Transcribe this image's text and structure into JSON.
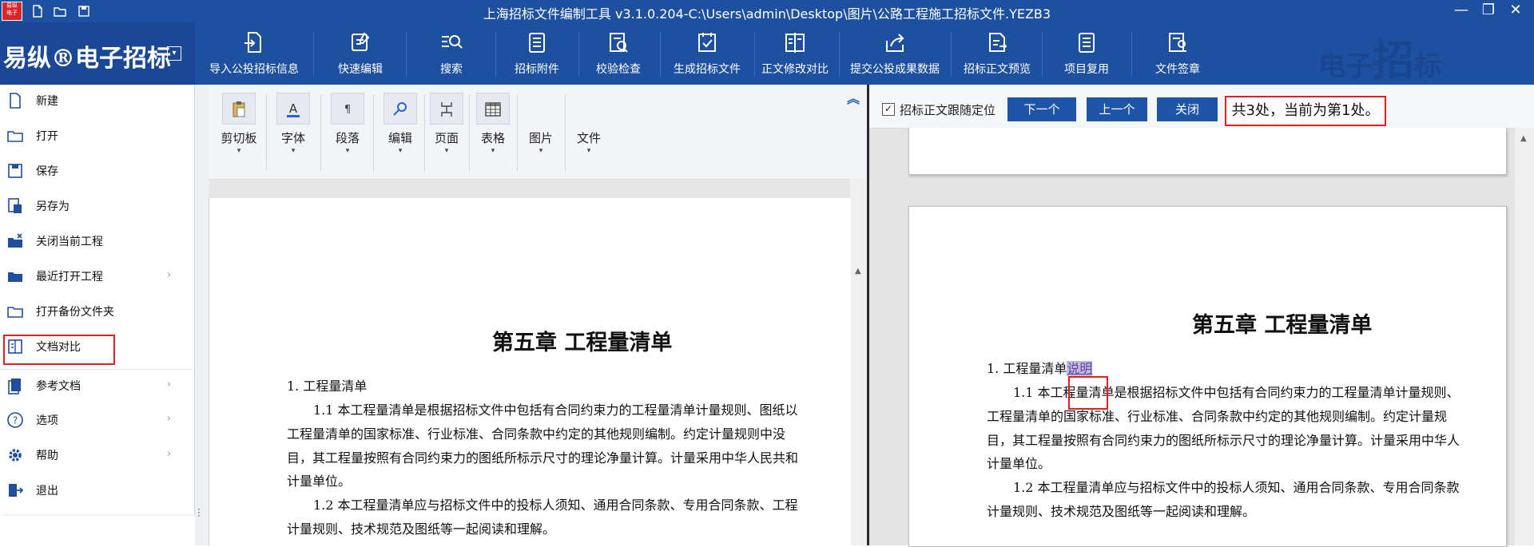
{
  "titlebar": {
    "logo_text": "易纵电子招标",
    "title": "上海招标文件编制工具 v3.1.0.204-C:\\Users\\admin\\Desktop\\图片\\公路工程施工招标文件.YEZB3",
    "quick_icons": [
      "new-file-icon",
      "open-folder-icon",
      "save-icon"
    ],
    "window_buttons": [
      "minimize-icon",
      "restore-icon",
      "close-icon"
    ]
  },
  "brand": {
    "name": "易纵®电子招标",
    "dropdown_icon": "chevron-down-icon"
  },
  "ribbon": {
    "buttons": [
      {
        "label": "导入公投招标信息",
        "icon": "import-icon"
      },
      {
        "label": "快速编辑",
        "icon": "edit-icon"
      },
      {
        "label": "搜索",
        "icon": "search-list-icon"
      },
      {
        "label": "招标附件",
        "icon": "attachment-icon"
      },
      {
        "label": "校验检查",
        "icon": "check-doc-icon"
      },
      {
        "label": "生成招标文件",
        "icon": "generate-icon"
      },
      {
        "label": "正文修改对比",
        "icon": "compare-icon"
      },
      {
        "label": "提交公投成果数据",
        "icon": "share-icon"
      },
      {
        "label": "招标正文预览",
        "icon": "preview-icon"
      },
      {
        "label": "项目复用",
        "icon": "reuse-icon"
      },
      {
        "label": "文件签章",
        "icon": "seal-icon"
      }
    ],
    "watermark": {
      "left": "电子",
      "big": "招",
      "right": "标"
    }
  },
  "file_menu": {
    "items": [
      {
        "label": "新建",
        "icon": "new-file-icon",
        "submenu": false
      },
      {
        "label": "打开",
        "icon": "open-folder-icon",
        "submenu": false
      },
      {
        "label": "保存",
        "icon": "save-icon",
        "submenu": false
      },
      {
        "label": "另存为",
        "icon": "save-as-icon",
        "submenu": false
      },
      {
        "label": "关闭当前工程",
        "icon": "close-folder-icon",
        "submenu": false
      },
      {
        "label": "最近打开工程",
        "icon": "recent-folder-icon",
        "submenu": true
      },
      {
        "label": "打开备份文件夹",
        "icon": "backup-folder-icon",
        "submenu": false
      },
      {
        "label": "文档对比",
        "icon": "doc-compare-icon",
        "submenu": false,
        "highlighted": true
      },
      {
        "label": "参考文档",
        "icon": "reference-doc-icon",
        "submenu": true
      },
      {
        "label": "选项",
        "icon": "question-icon",
        "submenu": true
      },
      {
        "label": "帮助",
        "icon": "gear-icon",
        "submenu": true
      },
      {
        "label": "退出",
        "icon": "exit-icon",
        "submenu": false
      }
    ]
  },
  "editor_toolbar": {
    "groups": [
      {
        "label": "剪切板",
        "icon": "clipboard-icon"
      },
      {
        "label": "字体",
        "icon": "font-color-icon"
      },
      {
        "label": "段落",
        "icon": "paragraph-icon"
      },
      {
        "label": "编辑",
        "icon": "find-icon"
      },
      {
        "label": "页面",
        "icon": "page-icon"
      },
      {
        "label": "表格",
        "icon": "table-icon"
      },
      {
        "label": "图片",
        "icon": ""
      },
      {
        "label": "文件",
        "icon": ""
      }
    ],
    "dropdown_glyph": "▾",
    "collapse_glyph": "︽"
  },
  "left_doc": {
    "chapter_title": "第五章  工程量清单",
    "lines": [
      "1. 工程量清单",
      "1.1    本工程量清单是根据招标文件中包括有合同约束力的工程量清单计量规则、图纸以",
      "工程量清单的国家标准、行业标准、合同条款中约定的其他规则编制。约定计量规则中没",
      "目，其工程量按照有合同约束力的图纸所标示尺寸的理论净量计算。计量采用中华人民共和",
      "计量单位。",
      "1.2    本工程量清单应与招标文件中的投标人须知、通用合同条款、专用合同条款、工程",
      "计量规则、技术规范及图纸等一起阅读和理解。"
    ]
  },
  "find_bar": {
    "checkbox_label": "招标正文跟随定位",
    "checked": true,
    "next_label": "下一个",
    "prev_label": "上一个",
    "close_label": "关闭",
    "status": "共3处，当前为第1处。"
  },
  "right_doc": {
    "chapter_title": "第五章  工程量清单",
    "line1_prefix": "1. 工程量清单",
    "marked_word": "说明",
    "lines": [
      "1.1    本工程量清单是根据招标文件中包括有合同约束力的工程量清单计量规则、",
      "工程量清单的国家标准、行业标准、合同条款中约定的其他规则编制。约定计量规",
      "目，其工程量按照有合同约束力的图纸所标示尺寸的理论净量计算。计量采用中华人",
      "计量单位。",
      "1.2    本工程量清单应与招标文件中的投标人须知、通用合同条款、专用合同条款",
      "计量规则、技术规范及图纸等一起阅读和理解。"
    ]
  },
  "colors": {
    "ribbon_blue": "#1e50a2",
    "highlight_red": "#e02020",
    "button_blue": "#1f55a8"
  }
}
